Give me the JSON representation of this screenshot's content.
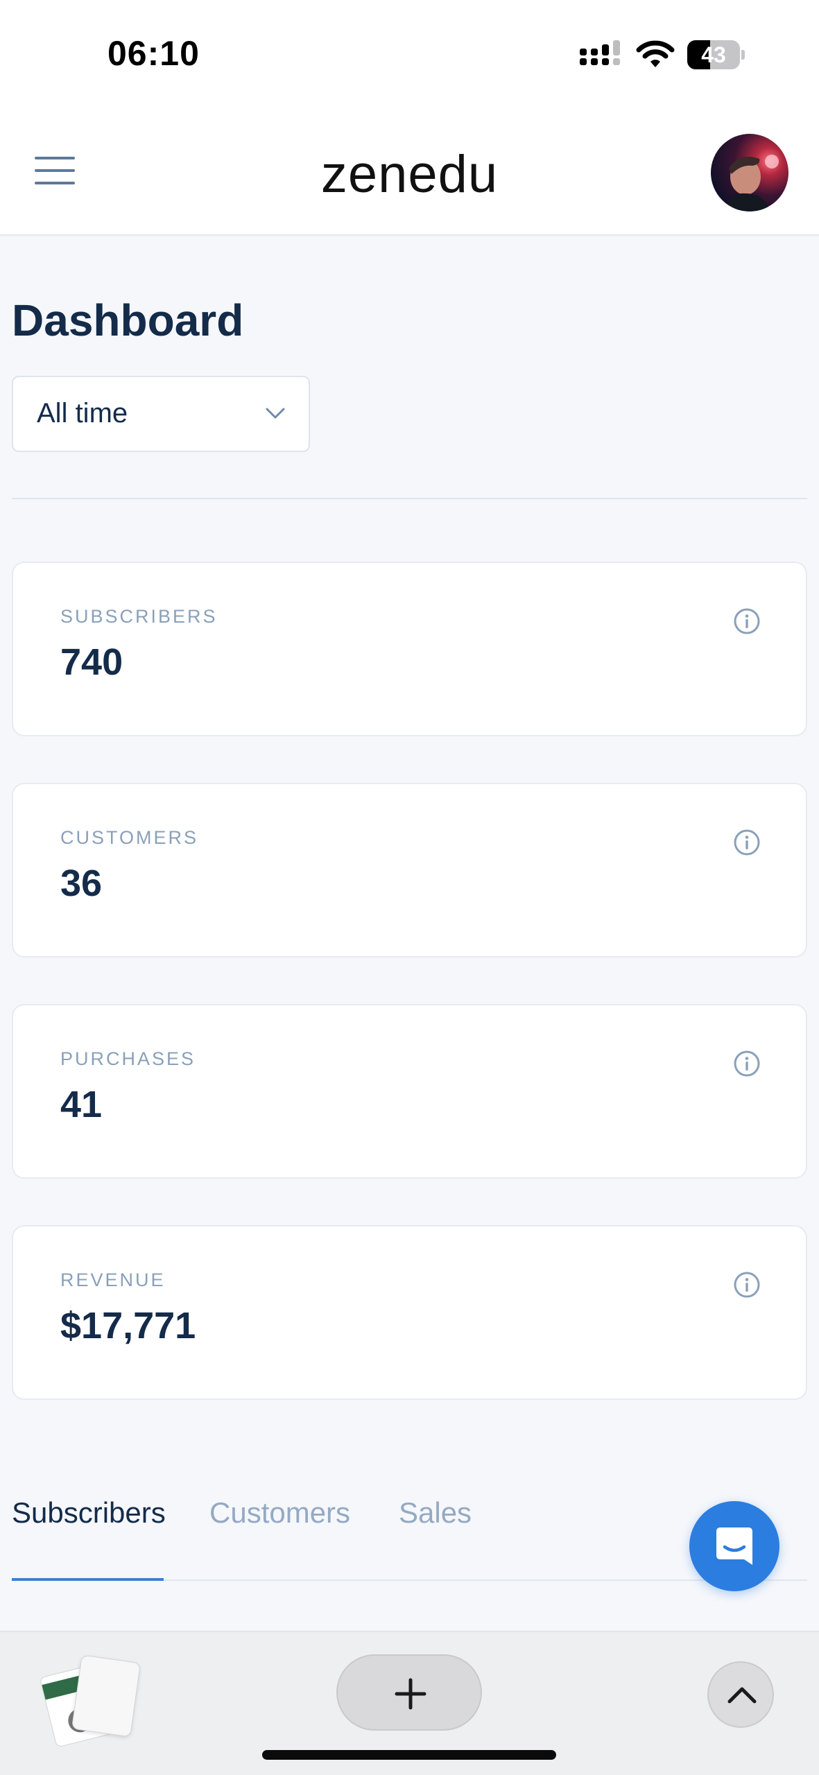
{
  "status_bar": {
    "time": "06:10",
    "battery_level": "43"
  },
  "header": {
    "brand": "zenedu",
    "menu_icon": "hamburger-menu-icon",
    "avatar_icon": "user-avatar"
  },
  "dashboard": {
    "title": "Dashboard",
    "range": {
      "selected": "All time",
      "icon": "chevron-down-icon"
    },
    "stats": [
      {
        "label": "SUBSCRIBERS",
        "value": "740"
      },
      {
        "label": "CUSTOMERS",
        "value": "36"
      },
      {
        "label": "PURCHASES",
        "value": "41"
      },
      {
        "label": "REVENUE",
        "value": "$17,771"
      }
    ],
    "tabs": [
      {
        "label": "Subscribers",
        "active": true
      },
      {
        "label": "Customers",
        "active": false
      },
      {
        "label": "Sales",
        "active": false
      }
    ]
  },
  "chat_widget": {
    "icon": "chat-bubble-icon"
  },
  "browser_toolbar": {
    "tabs_icon": "tab-thumbnails",
    "new_tab_icon": "plus-icon",
    "scroll_up_icon": "chevron-up-icon"
  },
  "colors": {
    "primary_text": "#142b4a",
    "muted_text": "#8aa0ba",
    "accent": "#2b7de0",
    "tab_underline": "#3d7fd1",
    "page_background": "#f5f7fb"
  }
}
